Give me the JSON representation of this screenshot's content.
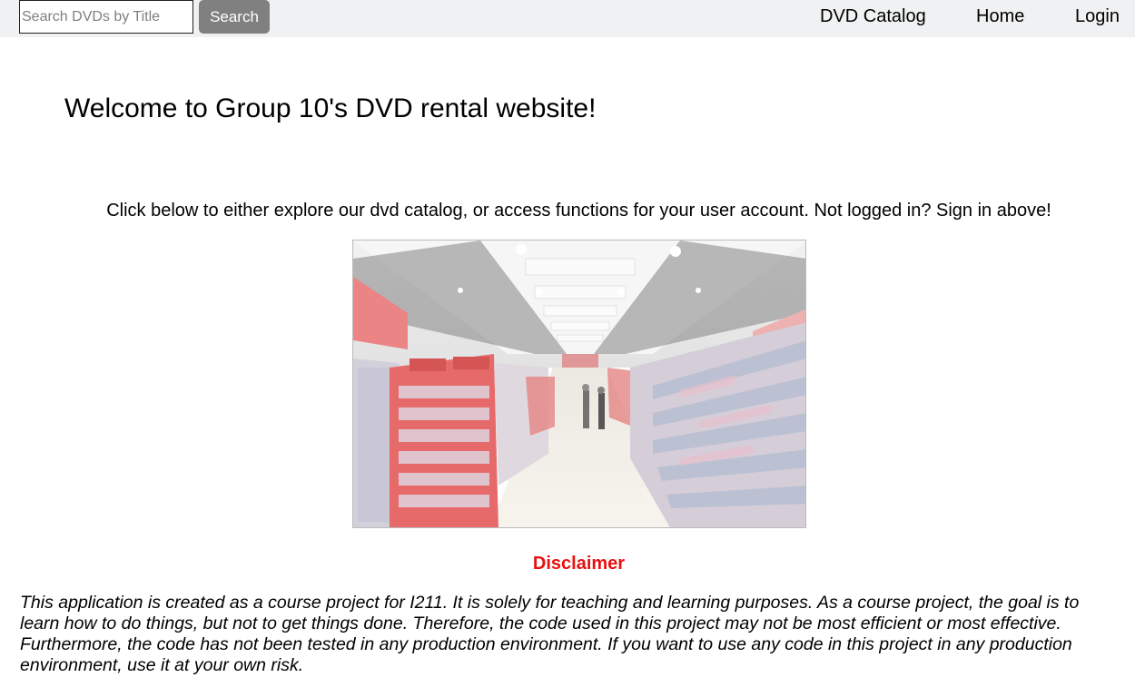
{
  "header": {
    "search": {
      "placeholder": "Search DVDs by Title",
      "value": "",
      "button_label": "Search"
    },
    "nav": {
      "catalog": "DVD Catalog",
      "home": "Home",
      "login": "Login"
    }
  },
  "main": {
    "welcome_title": "Welcome to Group 10's DVD rental website!",
    "intro_text": "Click below to either explore our dvd catalog, or access functions for your user account. Not logged in? Sign in above!",
    "image": {
      "alt": "DVD store interior"
    },
    "disclaimer": {
      "title": "Disclaimer",
      "text": "This application is created as a course project for I211. It is solely for teaching and learning purposes. As a course project, the goal is to learn how to do things, but not to get things done. Therefore, the code used in this project may not be most efficient or most effective. Furthermore, the code has not been tested in any production environment. If you want to use any code in this project in any production environment, use it at your own risk."
    }
  },
  "colors": {
    "navbar_bg": "#f0f1f2",
    "search_button_bg": "#808080",
    "disclaimer_title": "#e81010"
  }
}
